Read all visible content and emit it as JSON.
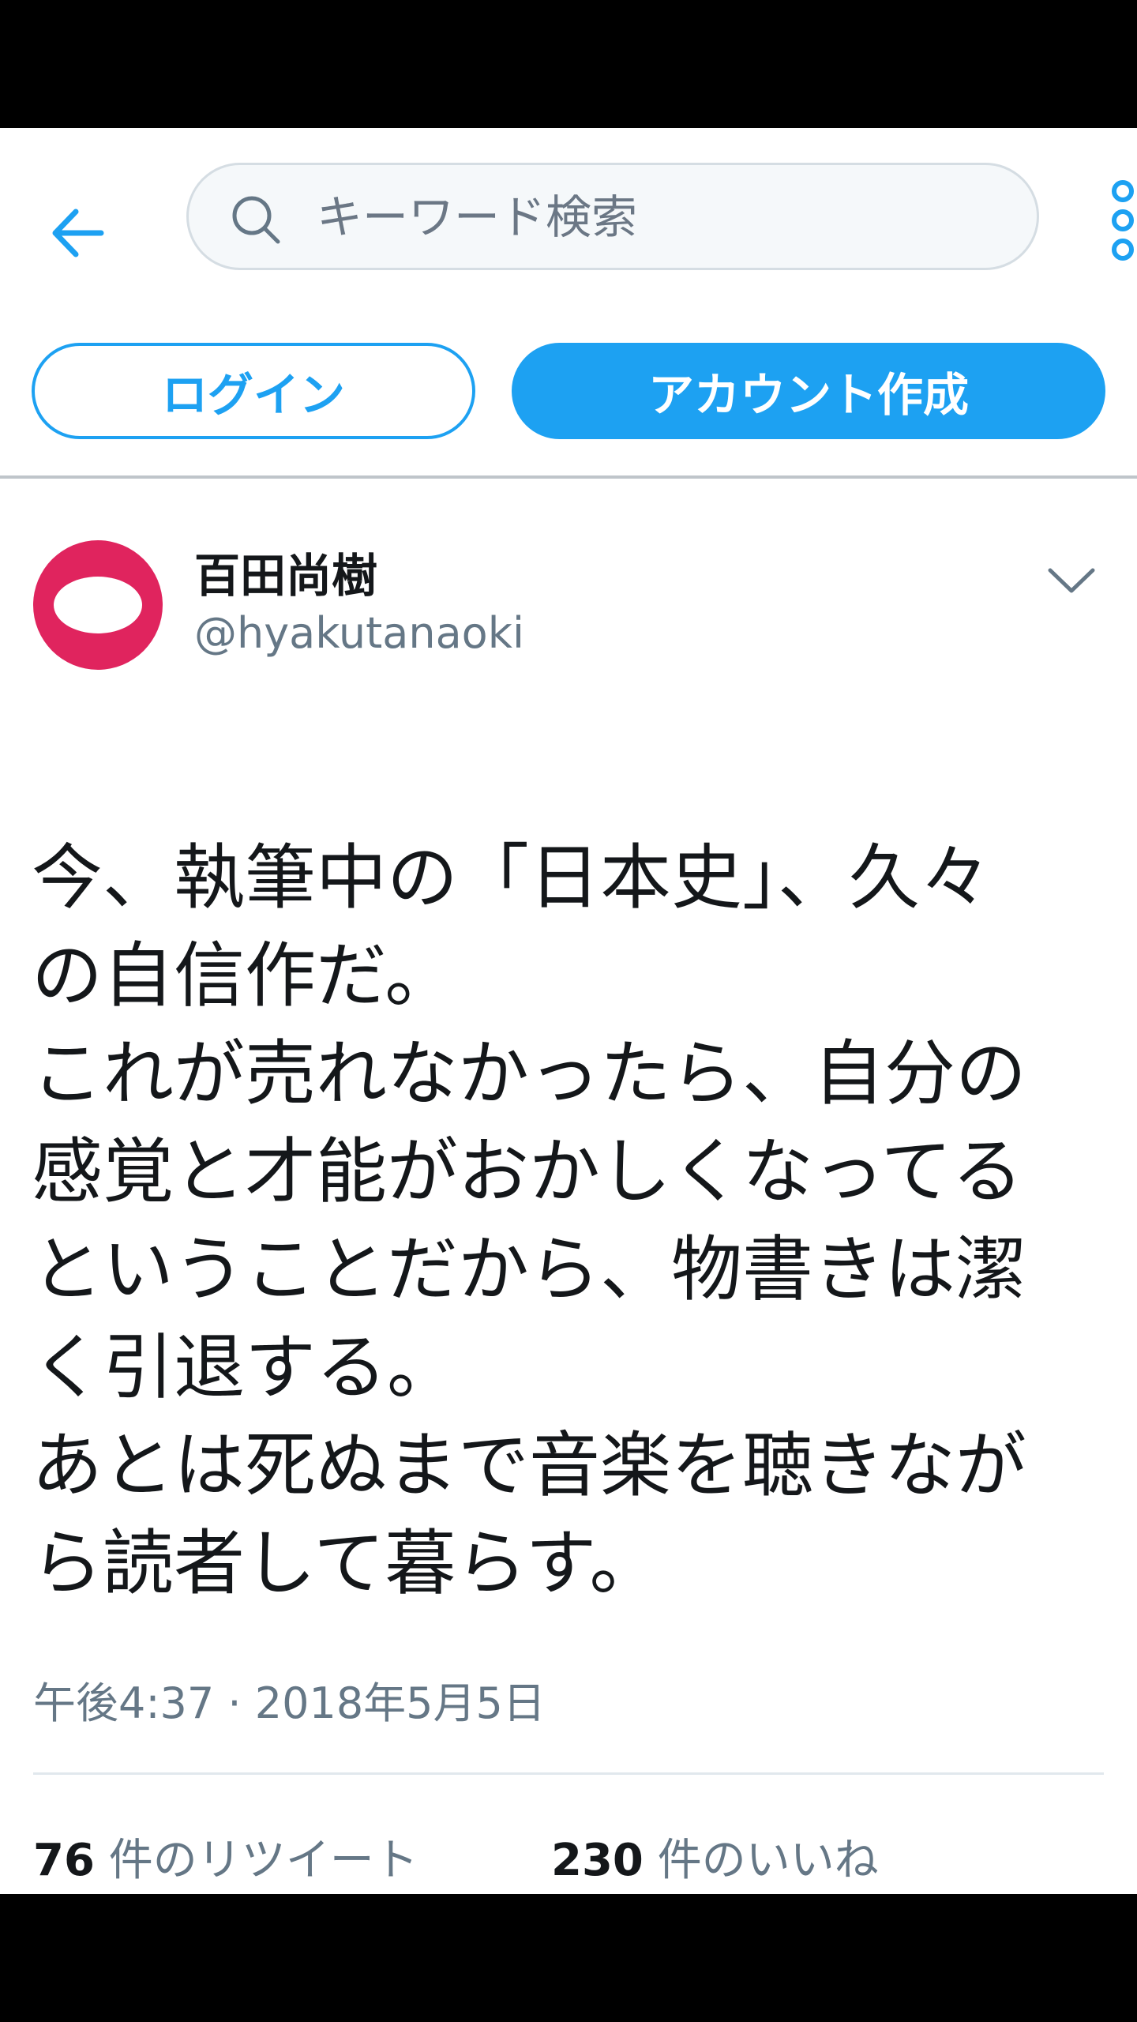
{
  "header": {
    "search_placeholder": "キーワード検索"
  },
  "auth": {
    "login_label": "ログイン",
    "signup_label": "アカウント作成"
  },
  "tweet": {
    "display_name": "百田尚樹",
    "handle": "@hyakutanaoki",
    "text": "今、執筆中の「日本史」、久々\nの自信作だ。\nこれが売れなかったら、自分の\n感覚と才能がおかしくなってる\nということだから、物書きは潔\nく引退する。\nあとは死ぬまで音楽を聴きなが\nら読者して暮らす。",
    "timestamp": "午後4:37 · 2018年5月5日",
    "retweet_count": "76",
    "retweet_label": " 件のリツイート",
    "like_count": "230",
    "like_label": " 件のいいね"
  },
  "colors": {
    "accent": "#1da1f2",
    "avatar": "#e0245e",
    "secondary_text": "#657786"
  }
}
